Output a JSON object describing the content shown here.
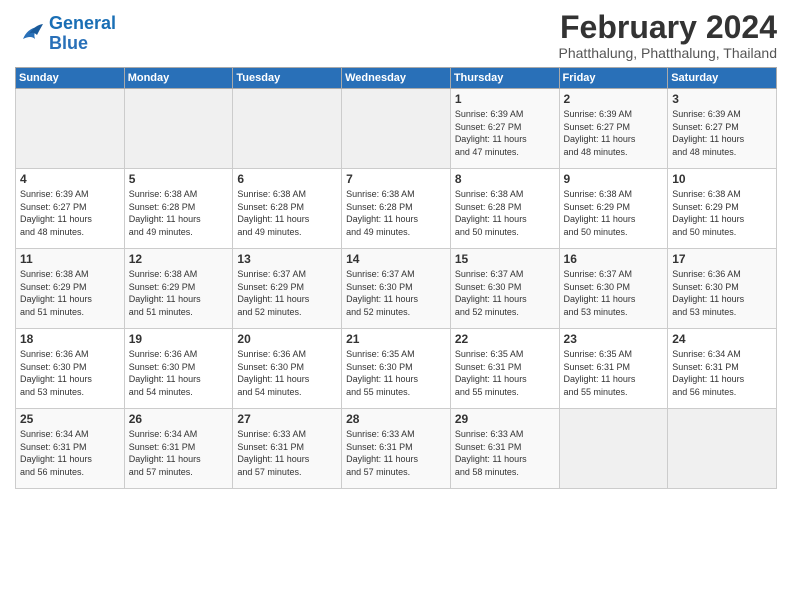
{
  "logo": {
    "line1": "General",
    "line2": "Blue"
  },
  "header": {
    "month": "February 2024",
    "location": "Phatthalung, Phatthalung, Thailand"
  },
  "weekdays": [
    "Sunday",
    "Monday",
    "Tuesday",
    "Wednesday",
    "Thursday",
    "Friday",
    "Saturday"
  ],
  "weeks": [
    [
      {
        "day": "",
        "info": ""
      },
      {
        "day": "",
        "info": ""
      },
      {
        "day": "",
        "info": ""
      },
      {
        "day": "",
        "info": ""
      },
      {
        "day": "1",
        "info": "Sunrise: 6:39 AM\nSunset: 6:27 PM\nDaylight: 11 hours\nand 47 minutes."
      },
      {
        "day": "2",
        "info": "Sunrise: 6:39 AM\nSunset: 6:27 PM\nDaylight: 11 hours\nand 48 minutes."
      },
      {
        "day": "3",
        "info": "Sunrise: 6:39 AM\nSunset: 6:27 PM\nDaylight: 11 hours\nand 48 minutes."
      }
    ],
    [
      {
        "day": "4",
        "info": "Sunrise: 6:39 AM\nSunset: 6:27 PM\nDaylight: 11 hours\nand 48 minutes."
      },
      {
        "day": "5",
        "info": "Sunrise: 6:38 AM\nSunset: 6:28 PM\nDaylight: 11 hours\nand 49 minutes."
      },
      {
        "day": "6",
        "info": "Sunrise: 6:38 AM\nSunset: 6:28 PM\nDaylight: 11 hours\nand 49 minutes."
      },
      {
        "day": "7",
        "info": "Sunrise: 6:38 AM\nSunset: 6:28 PM\nDaylight: 11 hours\nand 49 minutes."
      },
      {
        "day": "8",
        "info": "Sunrise: 6:38 AM\nSunset: 6:28 PM\nDaylight: 11 hours\nand 50 minutes."
      },
      {
        "day": "9",
        "info": "Sunrise: 6:38 AM\nSunset: 6:29 PM\nDaylight: 11 hours\nand 50 minutes."
      },
      {
        "day": "10",
        "info": "Sunrise: 6:38 AM\nSunset: 6:29 PM\nDaylight: 11 hours\nand 50 minutes."
      }
    ],
    [
      {
        "day": "11",
        "info": "Sunrise: 6:38 AM\nSunset: 6:29 PM\nDaylight: 11 hours\nand 51 minutes."
      },
      {
        "day": "12",
        "info": "Sunrise: 6:38 AM\nSunset: 6:29 PM\nDaylight: 11 hours\nand 51 minutes."
      },
      {
        "day": "13",
        "info": "Sunrise: 6:37 AM\nSunset: 6:29 PM\nDaylight: 11 hours\nand 52 minutes."
      },
      {
        "day": "14",
        "info": "Sunrise: 6:37 AM\nSunset: 6:30 PM\nDaylight: 11 hours\nand 52 minutes."
      },
      {
        "day": "15",
        "info": "Sunrise: 6:37 AM\nSunset: 6:30 PM\nDaylight: 11 hours\nand 52 minutes."
      },
      {
        "day": "16",
        "info": "Sunrise: 6:37 AM\nSunset: 6:30 PM\nDaylight: 11 hours\nand 53 minutes."
      },
      {
        "day": "17",
        "info": "Sunrise: 6:36 AM\nSunset: 6:30 PM\nDaylight: 11 hours\nand 53 minutes."
      }
    ],
    [
      {
        "day": "18",
        "info": "Sunrise: 6:36 AM\nSunset: 6:30 PM\nDaylight: 11 hours\nand 53 minutes."
      },
      {
        "day": "19",
        "info": "Sunrise: 6:36 AM\nSunset: 6:30 PM\nDaylight: 11 hours\nand 54 minutes."
      },
      {
        "day": "20",
        "info": "Sunrise: 6:36 AM\nSunset: 6:30 PM\nDaylight: 11 hours\nand 54 minutes."
      },
      {
        "day": "21",
        "info": "Sunrise: 6:35 AM\nSunset: 6:30 PM\nDaylight: 11 hours\nand 55 minutes."
      },
      {
        "day": "22",
        "info": "Sunrise: 6:35 AM\nSunset: 6:31 PM\nDaylight: 11 hours\nand 55 minutes."
      },
      {
        "day": "23",
        "info": "Sunrise: 6:35 AM\nSunset: 6:31 PM\nDaylight: 11 hours\nand 55 minutes."
      },
      {
        "day": "24",
        "info": "Sunrise: 6:34 AM\nSunset: 6:31 PM\nDaylight: 11 hours\nand 56 minutes."
      }
    ],
    [
      {
        "day": "25",
        "info": "Sunrise: 6:34 AM\nSunset: 6:31 PM\nDaylight: 11 hours\nand 56 minutes."
      },
      {
        "day": "26",
        "info": "Sunrise: 6:34 AM\nSunset: 6:31 PM\nDaylight: 11 hours\nand 57 minutes."
      },
      {
        "day": "27",
        "info": "Sunrise: 6:33 AM\nSunset: 6:31 PM\nDaylight: 11 hours\nand 57 minutes."
      },
      {
        "day": "28",
        "info": "Sunrise: 6:33 AM\nSunset: 6:31 PM\nDaylight: 11 hours\nand 57 minutes."
      },
      {
        "day": "29",
        "info": "Sunrise: 6:33 AM\nSunset: 6:31 PM\nDaylight: 11 hours\nand 58 minutes."
      },
      {
        "day": "",
        "info": ""
      },
      {
        "day": "",
        "info": ""
      }
    ]
  ]
}
